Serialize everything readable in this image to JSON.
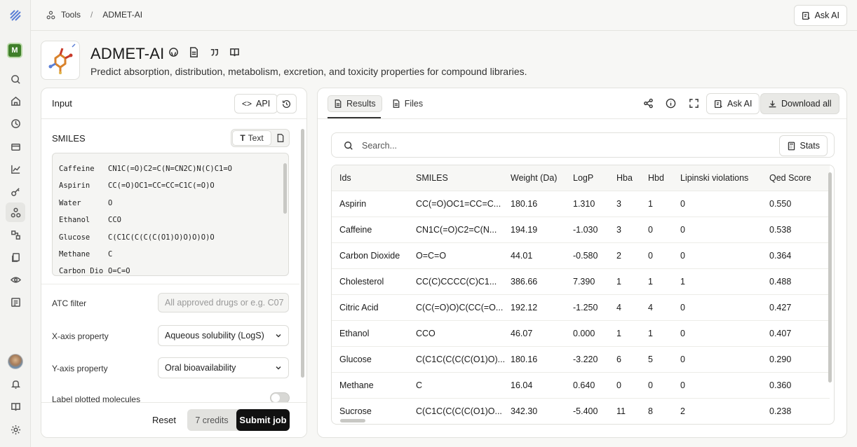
{
  "breadcrumb": {
    "root": "Tools",
    "sep": "/",
    "current": "ADMET-AI"
  },
  "top_actions": {
    "ask_ai": "Ask AI"
  },
  "user": {
    "org_initial": "M"
  },
  "tool": {
    "title": "ADMET-AI",
    "subtitle": "Predict absorption, distribution, metabolism, excretion, and toxicity properties for compound libraries."
  },
  "input_panel": {
    "title": "Input",
    "api_label": "API",
    "smiles_label": "SMILES",
    "text_toggle": "Text",
    "smiles_rows": [
      {
        "name": "Caffeine",
        "smiles": "CN1C(=O)C2=C(N=CN2C)N(C)C1=O"
      },
      {
        "name": "Aspirin",
        "smiles": "CC(=O)OC1=CC=CC=C1C(=O)O"
      },
      {
        "name": "Water",
        "smiles": "O"
      },
      {
        "name": "Ethanol",
        "smiles": "CCO"
      },
      {
        "name": "Glucose",
        "smiles": "C(C1C(C(C(C(O1)O)O)O)O)O"
      },
      {
        "name": "Methane",
        "smiles": "C"
      },
      {
        "name": "Carbon Dio",
        "smiles": "O=C=O"
      }
    ],
    "atc_label": "ATC filter",
    "atc_placeholder": "All approved drugs or e.g. C07",
    "x_axis_label": "X-axis property",
    "x_axis_value": "Aqueous solubility (LogS)",
    "y_axis_label": "Y-axis property",
    "y_axis_value": "Oral bioavailability",
    "label_plotted": "Label plotted molecules",
    "reset": "Reset",
    "credits": "7 credits",
    "submit": "Submit job"
  },
  "results_panel": {
    "tab_results": "Results",
    "tab_files": "Files",
    "ask_ai": "Ask AI",
    "download_all": "Download all",
    "search_placeholder": "Search...",
    "stats": "Stats",
    "columns": [
      "Ids",
      "SMILES",
      "Weight (Da)",
      "LogP",
      "Hba",
      "Hbd",
      "Lipinski violations",
      "Qed Score"
    ],
    "rows": [
      [
        "Aspirin",
        "CC(=O)OC1=CC=C...",
        "180.16",
        "1.310",
        "3",
        "1",
        "0",
        "0.550"
      ],
      [
        "Caffeine",
        "CN1C(=O)C2=C(N...",
        "194.19",
        "-1.030",
        "3",
        "0",
        "0",
        "0.538"
      ],
      [
        "Carbon Dioxide",
        "O=C=O",
        "44.01",
        "-0.580",
        "2",
        "0",
        "0",
        "0.364"
      ],
      [
        "Cholesterol",
        "CC(C)CCCC(C)C1...",
        "386.66",
        "7.390",
        "1",
        "1",
        "1",
        "0.488"
      ],
      [
        "Citric Acid",
        "C(C(=O)O)C(CC(=O...",
        "192.12",
        "-1.250",
        "4",
        "4",
        "0",
        "0.427"
      ],
      [
        "Ethanol",
        "CCO",
        "46.07",
        "0.000",
        "1",
        "1",
        "0",
        "0.407"
      ],
      [
        "Glucose",
        "C(C1C(C(C(C(O1)O)...",
        "180.16",
        "-3.220",
        "6",
        "5",
        "0",
        "0.290"
      ],
      [
        "Methane",
        "C",
        "16.04",
        "0.640",
        "0",
        "0",
        "0",
        "0.360"
      ],
      [
        "Sucrose",
        "C(C1C(C(C(C(O1)O...",
        "342.30",
        "-5.400",
        "11",
        "8",
        "2",
        "0.238"
      ]
    ]
  },
  "icons": {
    "rail": [
      "logo-icon",
      "search-icon",
      "home-icon",
      "history-icon",
      "card-icon",
      "chart-icon",
      "key-icon",
      "tools-icon",
      "workflow-icon",
      "files-icon",
      "eye-icon",
      "notes-icon",
      "bell-icon",
      "book-icon",
      "gear-icon"
    ]
  }
}
